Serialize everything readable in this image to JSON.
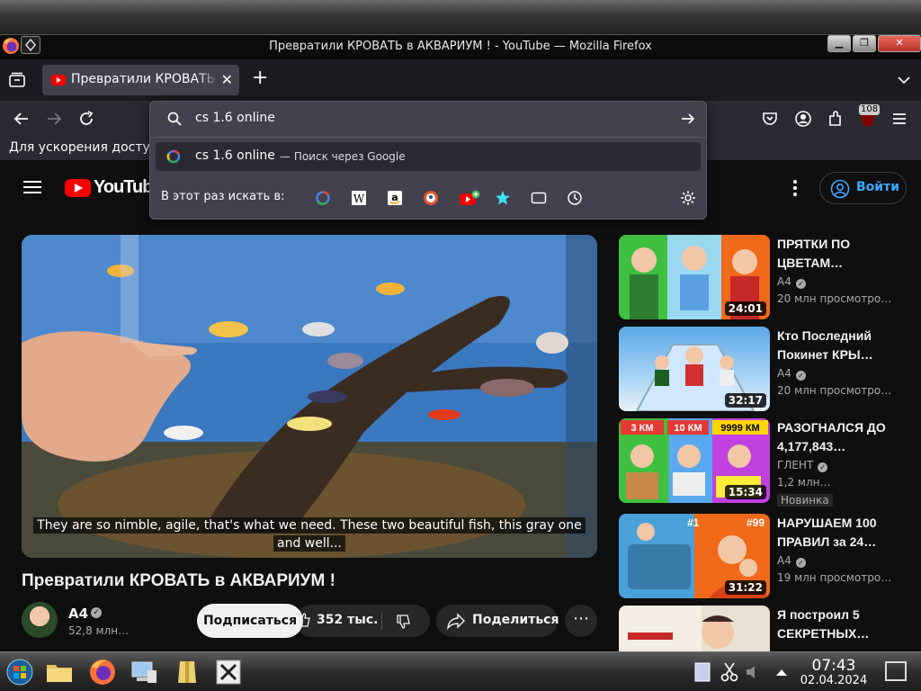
{
  "window": {
    "title": "Превратили КРОВАТЬ в АКВАРИУМ ! - YouTube — Mozilla Firefox",
    "buttons": {
      "minimize": "▁",
      "maximize": "❐",
      "close": "✕"
    }
  },
  "tabs": [
    {
      "label": "Превратили КРОВАТЬ в АКВАРИУМ !",
      "close": "✕",
      "favicon": "youtube-icon"
    }
  ],
  "tabbar": {
    "new_tab": "+"
  },
  "toolbar": {
    "extensions_badge": "108"
  },
  "bookmarks_notice": "Для ускорения доступа разместите свои закладки здесь, на панели закладок.",
  "urlbar": {
    "value": "cs 1.6 online",
    "suggestion_main": "cs 1.6 online",
    "suggestion_sub": "— Поиск через Google",
    "oneoff_label": "В этот раз искать в:",
    "engines": [
      "google",
      "wikipedia",
      "amazon",
      "duckduckgo",
      "youtube",
      "bookmarks",
      "tabs",
      "history"
    ]
  },
  "youtube": {
    "logo_text": "YouTube",
    "signin": "Войти",
    "caption_line1": "They are so nimble, agile, that's what we need. These two beautiful fish, this gray one",
    "caption_line2": "and well...",
    "video_title": "Превратили КРОВАТЬ в АКВАРИУМ !",
    "channel": "A4",
    "subscribers": "52,8 млн…",
    "subscribe": "Подписаться",
    "likes": "352 тыс.",
    "share": "Поделиться",
    "more": "⋯"
  },
  "recommendations": [
    {
      "title": "ПРЯТКИ ПО ЦВЕТАМ…",
      "channel": "A4",
      "views": "20 млн просмотро…",
      "duration": "24:01"
    },
    {
      "title": "Кто Последний Покинет КРЫ…",
      "channel": "A4",
      "views": "20 млн просмотро…",
      "duration": "32:17"
    },
    {
      "title": "РАЗОГНАЛСЯ ДО 4,177,843…",
      "channel": "ГЛЕНТ",
      "views": "1,2 млн…",
      "duration": "15:34",
      "badge": "Новинка",
      "thumb_labels": [
        "3 КМ",
        "10 КМ",
        "9999 КМ"
      ]
    },
    {
      "title": "НАРУШАЕМ 100 ПРАВИЛ за 24…",
      "channel": "A4",
      "views": "19 млн просмотро…",
      "duration": "31:22",
      "thumb_labels": [
        "#1",
        "#99"
      ]
    },
    {
      "title": "Я построил 5 СЕКРЕТНЫХ…",
      "channel": "",
      "views": "",
      "duration": ""
    }
  ],
  "taskbar": {
    "time": "07:43",
    "date": "02.04.2024"
  },
  "colors": {
    "youtube_red": "#ff0000",
    "signin_blue": "#3ea6ff",
    "firefox_toolbar": "#2b2a33",
    "urlbar_panel": "#42414d"
  }
}
